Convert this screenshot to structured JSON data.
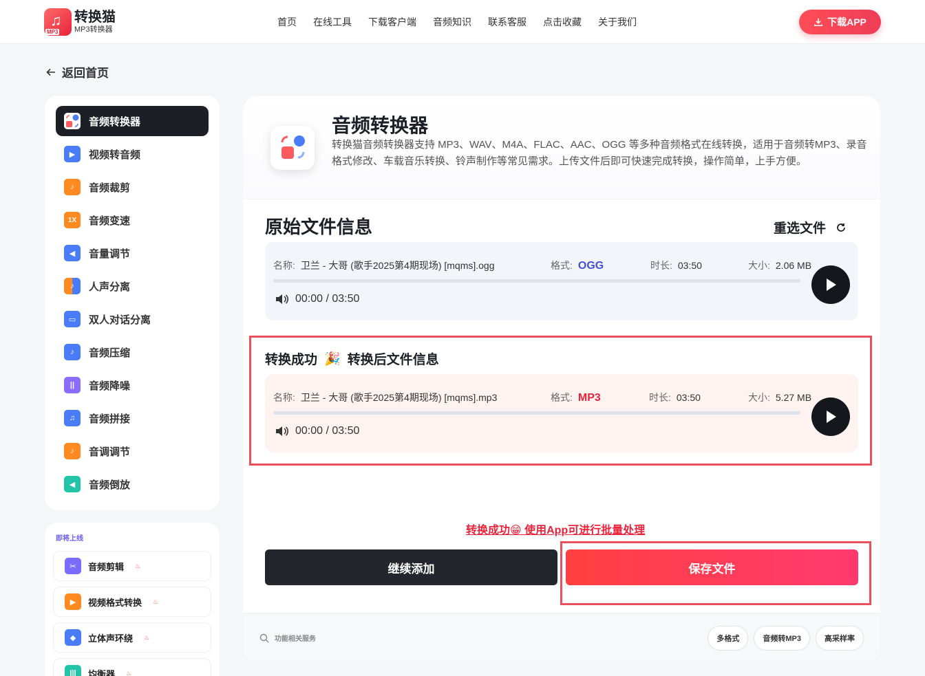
{
  "header": {
    "logo_title": "转换猫",
    "logo_sub": "MP3转换器",
    "logo_tag": "MP3",
    "nav": [
      "首页",
      "在线工具",
      "下载客户端",
      "音频知识",
      "联系客服",
      "点击收藏",
      "关于我们"
    ],
    "download_label": "下载APP"
  },
  "back_label": "返回首页",
  "sidebar": {
    "items": [
      {
        "label": "音频转换器",
        "icon": "audio-convert-icon",
        "color": "#ff5a5f"
      },
      {
        "label": "视频转音频",
        "icon": "video-to-audio-icon",
        "color": "#4a7cf7"
      },
      {
        "label": "音频裁剪",
        "icon": "audio-cut-icon",
        "color": "#ff8a1f"
      },
      {
        "label": "音频变速",
        "icon": "speed-icon",
        "color": "#ff8a1f",
        "glyph": "1X"
      },
      {
        "label": "音量调节",
        "icon": "volume-icon",
        "color": "#4a7cf7"
      },
      {
        "label": "人声分离",
        "icon": "vocal-separate-icon",
        "color": "#ff8a1f"
      },
      {
        "label": "双人对话分离",
        "icon": "dialogue-icon",
        "color": "#4a7cf7"
      },
      {
        "label": "音频压缩",
        "icon": "compress-icon",
        "color": "#4a7cf7"
      },
      {
        "label": "音频降噪",
        "icon": "denoise-icon",
        "color": "#8a6cff"
      },
      {
        "label": "音频拼接",
        "icon": "merge-icon",
        "color": "#4a7cf7"
      },
      {
        "label": "音调调节",
        "icon": "pitch-icon",
        "color": "#ff8a1f"
      },
      {
        "label": "音频倒放",
        "icon": "reverse-icon",
        "color": "#22c3a6"
      }
    ]
  },
  "soon": {
    "title": "即将上线",
    "items": [
      {
        "label": "音频剪辑",
        "icon": "scissors-icon",
        "color": "#7a6cff"
      },
      {
        "label": "视频格式转换",
        "icon": "video-format-icon",
        "color": "#ff8a1f"
      },
      {
        "label": "立体声环绕",
        "icon": "cube-icon",
        "color": "#4a7cf7"
      },
      {
        "label": "均衡器",
        "icon": "equalizer-icon",
        "color": "#22c3a6"
      }
    ]
  },
  "hero": {
    "title": "音频转换器",
    "desc": "转换猫音频转换器支持 MP3、WAV、M4A、FLAC、AAC、OGG 等多种音频格式在线转换，适用于音频转MP3、录音格式修改、车载音乐转换、铃声制作等常见需求。上传文件后即可快速完成转换，操作简单，上手方便。"
  },
  "original": {
    "section_title": "原始文件信息",
    "reselect_label": "重选文件",
    "name_key": "名称:",
    "name": "卫兰 - 大哥 (歌手2025第4期现场) [mqms].ogg",
    "format_key": "格式:",
    "format": "OGG",
    "duration_key": "时长:",
    "duration": "03:50",
    "size_key": "大小:",
    "size": "2.06 MB",
    "time": "00:00 / 03:50",
    "progress": 0
  },
  "converted": {
    "title_left": "转换成功",
    "title_emoji": "🎉",
    "title_right": "转换后文件信息",
    "name_key": "名称:",
    "name": "卫兰 - 大哥 (歌手2025第4期现场) [mqms].mp3",
    "format_key": "格式:",
    "format": "MP3",
    "duration_key": "时长:",
    "duration": "03:50",
    "size_key": "大小:",
    "size": "5.27 MB",
    "time": "00:00 / 03:50",
    "progress": 0
  },
  "promo": "转换成功😁 使用App可进行批量处理",
  "actions": {
    "continue_label": "继续添加",
    "save_label": "保存文件"
  },
  "footer": {
    "search_placeholder": "功能相关服务",
    "chips": [
      "多格式",
      "音频转MP3",
      "高采样率"
    ]
  }
}
